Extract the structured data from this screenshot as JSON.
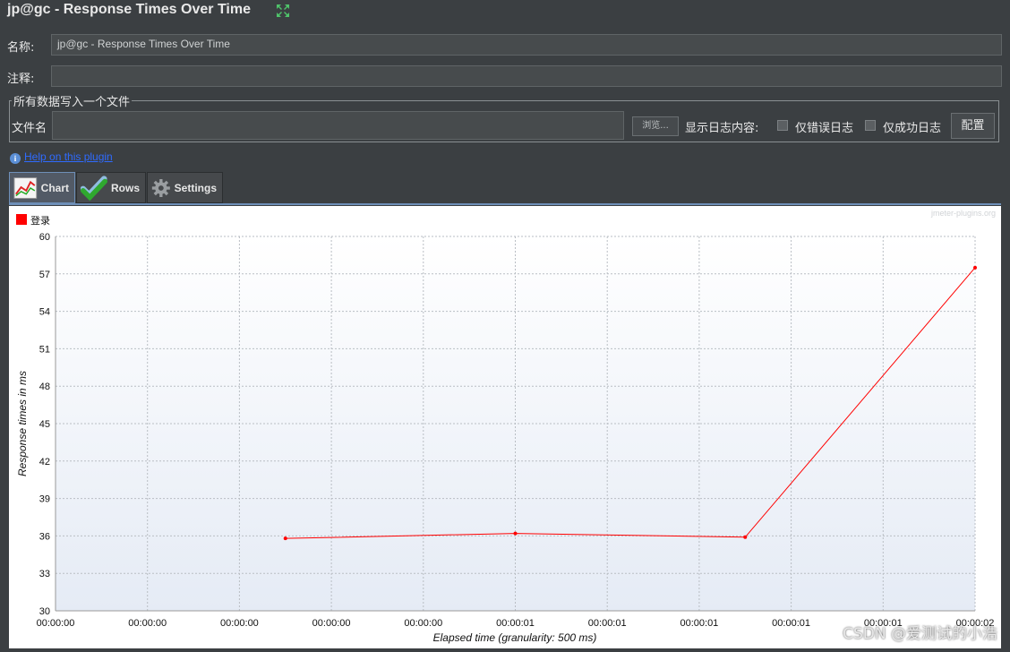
{
  "window": {
    "title": "jp@gc - Response Times Over Time"
  },
  "form": {
    "name_label": "名称:",
    "name_value": "jp@gc - Response Times Over Time",
    "comment_label": "注释:",
    "comment_value": ""
  },
  "file_group": {
    "title": "所有数据写入一个文件",
    "filename_label": "文件名",
    "filename_value": "",
    "browse_label": "浏览...",
    "log_label": "显示日志内容:",
    "errors_only_label": "仅错误日志",
    "errors_only_checked": false,
    "success_only_label": "仅成功日志",
    "success_only_checked": false,
    "configure_label": "配置"
  },
  "help": {
    "text": "Help on this plugin"
  },
  "tabs": [
    {
      "label": "Chart",
      "icon": "chart-icon",
      "active": true
    },
    {
      "label": "Rows",
      "icon": "checkmark-icon",
      "active": false
    },
    {
      "label": "Settings",
      "icon": "gear-icon",
      "active": false
    }
  ],
  "chart": {
    "brand": "jmeter-plugins.org"
  },
  "chart_data": {
    "type": "line",
    "title": "",
    "xlabel": "Elapsed time (granularity: 500 ms)",
    "ylabel": "Response times in ms",
    "x_ticks": [
      "00:00:00",
      "00:00:00",
      "00:00:00",
      "00:00:00",
      "00:00:00",
      "00:00:01",
      "00:00:01",
      "00:00:01",
      "00:00:01",
      "00:00:01",
      "00:00:02"
    ],
    "y_ticks": [
      30,
      33,
      36,
      39,
      42,
      45,
      48,
      51,
      54,
      57,
      60
    ],
    "ylim": [
      30,
      60
    ],
    "xlim_ms": [
      0,
      2000
    ],
    "grid": true,
    "legend_position": "top-left",
    "series": [
      {
        "name": "登录",
        "color": "#ff0000",
        "points": [
          {
            "x_ms": 500,
            "y": 35.8
          },
          {
            "x_ms": 1000,
            "y": 36.2
          },
          {
            "x_ms": 1500,
            "y": 35.9
          },
          {
            "x_ms": 2000,
            "y": 57.5
          }
        ]
      }
    ]
  },
  "watermark": {
    "text": "CSDN @爱测试的小浩"
  }
}
